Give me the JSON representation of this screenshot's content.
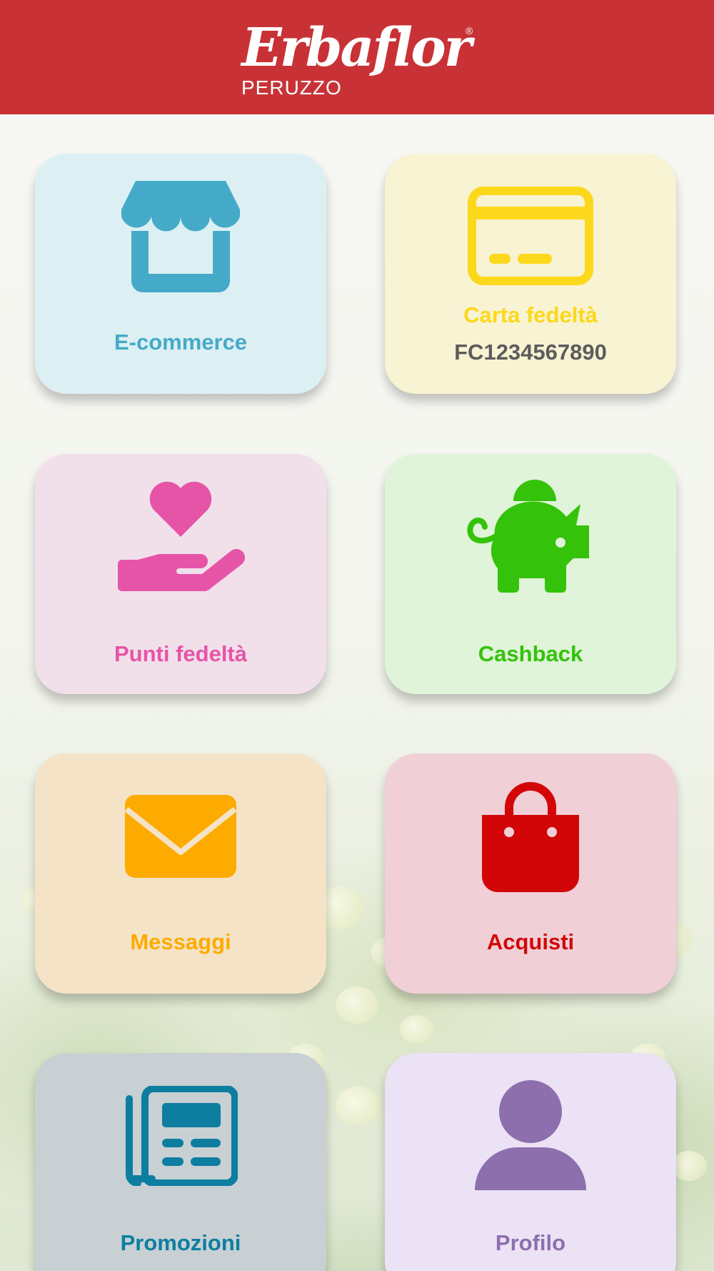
{
  "header": {
    "brand_name": "Erbaflor",
    "brand_sub": "PERUZZO",
    "registered": "®",
    "background": "#c83236"
  },
  "tiles": [
    {
      "id": "ecommerce",
      "label": "E-commerce",
      "icon": "store-icon",
      "color": "#45aac8",
      "background": "#dcf0f4"
    },
    {
      "id": "loyalty_card",
      "label": "Carta fedeltà",
      "value": "FC1234567890",
      "icon": "credit-card-icon",
      "color": "#fcd81c",
      "background": "#f8f3d2"
    },
    {
      "id": "loyalty_points",
      "label": "Punti fedeltà",
      "icon": "hand-heart-icon",
      "color": "#e654a8",
      "background": "#f1e0ea"
    },
    {
      "id": "cashback",
      "label": "Cashback",
      "icon": "piggy-bank-icon",
      "color": "#35c20a",
      "background": "#e0f4da"
    },
    {
      "id": "messages",
      "label": "Messaggi",
      "icon": "envelope-icon",
      "color": "#fdab00",
      "background": "#f4e3c6"
    },
    {
      "id": "purchases",
      "label": "Acquisti",
      "icon": "shopping-bag-icon",
      "color": "#d20608",
      "background": "#f0cfd6"
    },
    {
      "id": "promotions",
      "label": "Promozioni",
      "icon": "newspaper-icon",
      "color": "#0d7ea0",
      "background": "#c8d0d4"
    },
    {
      "id": "profile",
      "label": "Profilo",
      "icon": "user-icon",
      "color": "#8d6fae",
      "background": "#ebe2f5"
    }
  ]
}
